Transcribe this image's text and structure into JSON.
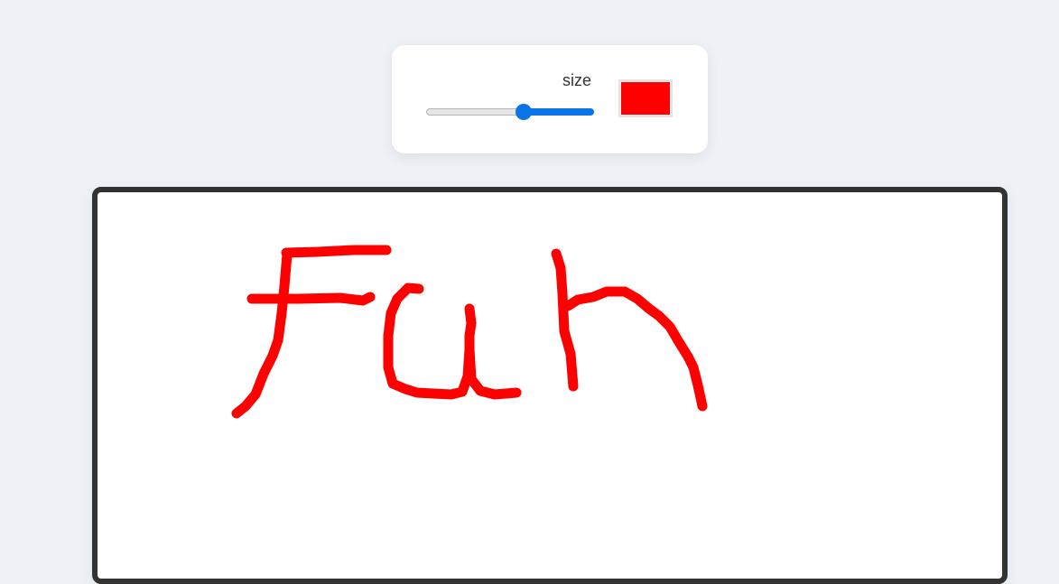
{
  "controls": {
    "size_label": "size",
    "size_value": 0.58,
    "color": "#ff0000",
    "slider_accent": "#0b74e8"
  },
  "canvas": {
    "stroke_color": "#ff0000",
    "border_color": "#333333",
    "background": "#ffffff"
  }
}
